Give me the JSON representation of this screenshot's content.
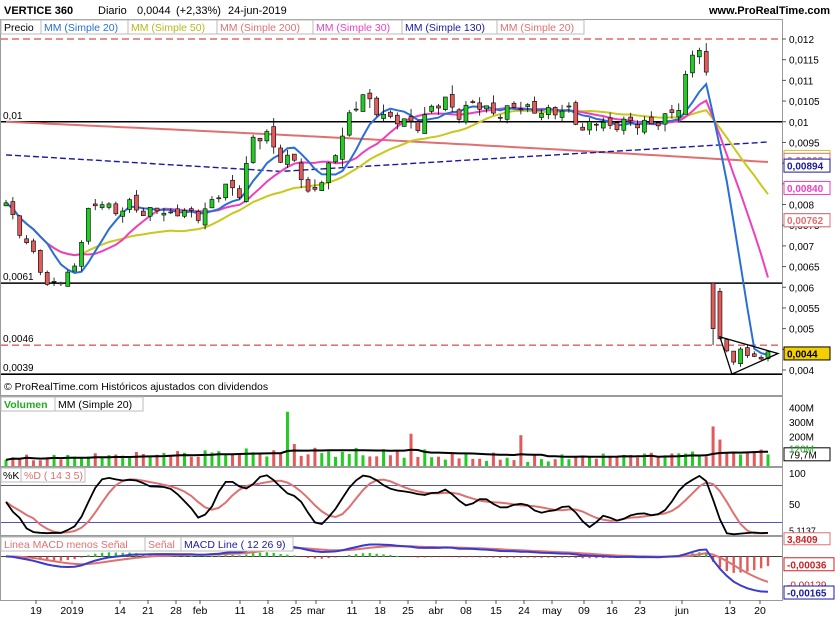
{
  "header": {
    "ticker": "VERTICE 360",
    "period": "Diario",
    "last": "0,0044",
    "change": "(+2,33%)",
    "date": "24-jun-2019",
    "site": "www.ProRealTime.com"
  },
  "copyright": "© ProRealTime.com  Históricos ajustados con dividendos",
  "legend": {
    "price": "Precio",
    "mm20": "MM (Simple 20)",
    "mm50": "MM (Simple 50)",
    "mm200": "MM (Simple 200)",
    "mm30": "MM (Simple 30)",
    "mm130": "MM (Simple 130)",
    "mm20b": "MM (Simple 20)",
    "volume": "Volumen",
    "volmm": "MM (Simple 20)",
    "stoch_k": "%K",
    "stoch_d": "%D ( 14 3 5)",
    "macd_hist": "Linea MACD menos Señal",
    "macd_signal": "Señal",
    "macd_line": "MACD Line ( 12 26 9)"
  },
  "colors": {
    "up": "#22cc22",
    "down": "#e25a5a",
    "mm20": "#2a6fd6",
    "mm50": "#c8c81e",
    "mm200": "#e07070",
    "mm30": "#ee3fbf",
    "mm130": "#1a1aa0",
    "resistance": "#cc2222",
    "last_badge": "#f5d000"
  },
  "chart_data": [
    {
      "panel": "price",
      "type": "candlestick",
      "y_axis_labels": [
        "0,012",
        "0,0115",
        "0,011",
        "0,0105",
        "0,01",
        "0,0095",
        "0,009",
        "0,0085",
        "0,008",
        "0,0075",
        "0,007",
        "0,0065",
        "0,006",
        "0,0055",
        "0,005",
        "0,0045",
        "0,004"
      ],
      "value_tags": [
        {
          "text": "0,00915",
          "value": 0.00915,
          "color": "#c8c81e"
        },
        {
          "text": "0,00908",
          "value": 0.00908,
          "color": "#e07070"
        },
        {
          "text": "0,00894",
          "value": 0.00894,
          "color": "#1a1aa0"
        },
        {
          "text": "0,00840",
          "value": 0.0084,
          "color": "#ee3fbf"
        },
        {
          "text": "0,00762",
          "value": 0.00762,
          "color": "#2a6fd6"
        },
        {
          "text": "0,00762",
          "value": 0.00762,
          "color": "#e07070"
        },
        {
          "text": "0,0044",
          "value": 0.0044,
          "color": "#f5d000"
        }
      ],
      "levels": [
        {
          "value": 0.012,
          "style": "dashed",
          "color": "#cc2222",
          "label": ""
        },
        {
          "value": 0.01,
          "style": "solid",
          "color": "#000000",
          "label": "0,01"
        },
        {
          "value": 0.0061,
          "style": "solid",
          "color": "#000000",
          "label": "0,0061"
        },
        {
          "value": 0.0046,
          "style": "dashed",
          "color": "#cc2222",
          "label": "0,0046"
        },
        {
          "value": 0.0039,
          "style": "solid",
          "color": "#000000",
          "label": "0,0039"
        }
      ],
      "ylim": [
        0.0038,
        0.01225
      ],
      "x_labels": [
        "19",
        "2019",
        "14",
        "21",
        "28",
        "feb",
        "11",
        "18",
        "25",
        "mar",
        "11",
        "18",
        "25",
        "abr",
        "08",
        "15",
        "24",
        "may",
        "09",
        "16",
        "23",
        "jun",
        "13",
        "20"
      ],
      "triangle": [
        [
          0.0046,
          0.0048
        ],
        [
          0.0046,
          0.0039
        ],
        [
          0.0044,
          0.0044
        ]
      ]
    },
    {
      "panel": "volume",
      "type": "bar",
      "y_axis_labels": [
        "400M",
        "300M",
        "200M",
        "79,7M"
      ],
      "last_volume_tag": "120M",
      "ylim": [
        0,
        450
      ]
    },
    {
      "panel": "stochastic",
      "type": "line",
      "y_axis_labels": [
        "100",
        "50"
      ],
      "value_tags": [
        {
          "text": "5,1137",
          "value": 5.1137
        },
        {
          "text": "3,8409",
          "value": 3.8409
        }
      ],
      "levels": [
        80,
        20
      ],
      "ylim": [
        0,
        100
      ]
    },
    {
      "panel": "macd",
      "type": "line",
      "value_tags": [
        {
          "text": "-0,00036",
          "value": -0.00036
        },
        {
          "text": "-0,00129",
          "value": -0.00129
        },
        {
          "text": "-0,00165",
          "value": -0.00165
        }
      ],
      "ylim": [
        -0.0019,
        0.0002
      ]
    }
  ]
}
